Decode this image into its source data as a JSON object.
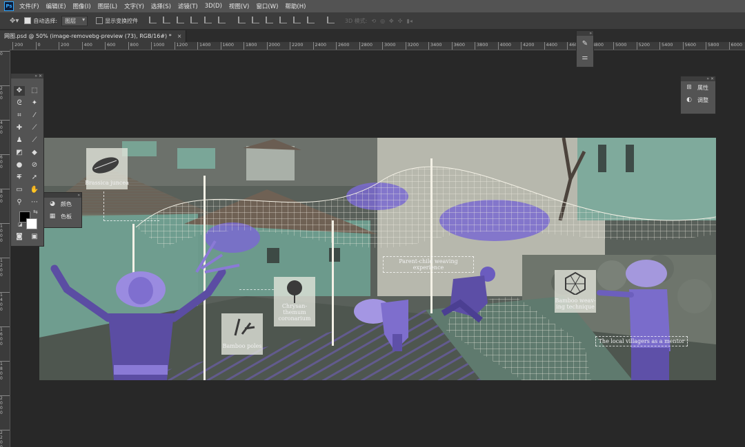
{
  "app": {
    "logo": "Ps"
  },
  "menu": [
    "文件(F)",
    "编辑(E)",
    "图像(I)",
    "图层(L)",
    "文字(Y)",
    "选择(S)",
    "滤镜(T)",
    "3D(D)",
    "视图(V)",
    "窗口(W)",
    "帮助(H)"
  ],
  "options_bar": {
    "auto_select_label": "自动选择:",
    "auto_select_checked": true,
    "layer_select_value": "图层",
    "show_transform_label": "显示变换控件",
    "show_transform_checked": false,
    "mode_3d_label": "3D 模式:"
  },
  "document_tab": {
    "title": "网图.psd @ 50% (image-removebg-preview (73), RGB/16#) *",
    "close": "×"
  },
  "ruler_h": [
    "200",
    "0",
    "200",
    "400",
    "600",
    "800",
    "1000",
    "1200",
    "1400",
    "1600",
    "1800",
    "2000",
    "2200",
    "2400",
    "2600",
    "2800",
    "3000",
    "3200",
    "3400",
    "3600",
    "3800",
    "4000",
    "4200",
    "4400",
    "4600",
    "4800",
    "5000",
    "5200",
    "5400",
    "5600",
    "5800",
    "6000"
  ],
  "ruler_v": [
    "0",
    "2 0 0",
    "4 0 0",
    "6 0 0",
    "8 0 0",
    "1 0 0 0",
    "1 2 0 0",
    "1 4 0 0",
    "1 6 0 0",
    "1 8 0 0",
    "2 0 0 0",
    "2 2 0 0"
  ],
  "canvas_labels": {
    "brassica": "Brassica juncea",
    "bamboo_poles": "Bamboo poles",
    "chrysanthemum": "Chrysan-\nthemum\ncoronarium",
    "parent_child": "Parent-child weaving experience",
    "bamboo_weaving": "Bamboo weav-\ning technique",
    "villagers": "The local villagers as a mentor"
  },
  "swatch_panel": {
    "color_label": "颜色",
    "swatches_label": "色板"
  },
  "right_panel": {
    "properties_label": "属性",
    "adjustments_label": "调整"
  },
  "colors": {
    "foreground": "#000000",
    "background": "#ffffff",
    "accent_purple": "#7a6ad0",
    "canvas_teal": "#6f9a8c"
  }
}
